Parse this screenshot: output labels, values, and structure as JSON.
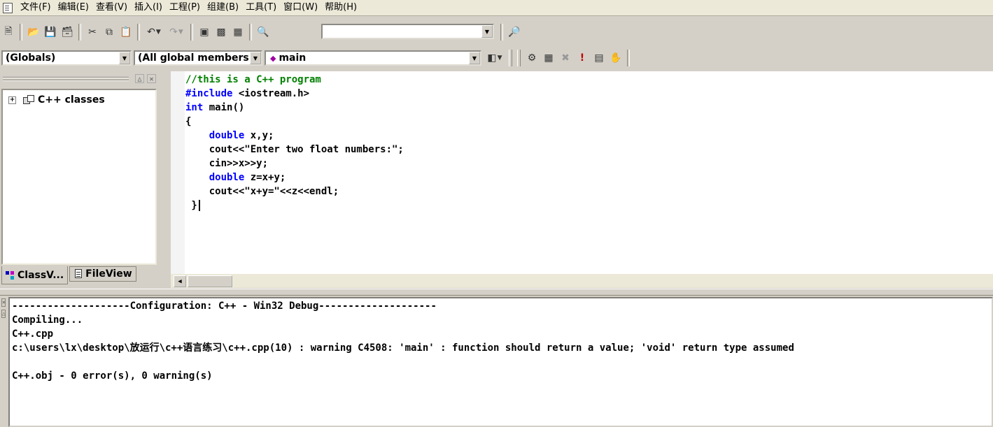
{
  "menubar": {
    "icon": "document-icon",
    "items": [
      "文件(F)",
      "编辑(E)",
      "查看(V)",
      "插入(I)",
      "工程(P)",
      "组建(B)",
      "工具(T)",
      "窗口(W)",
      "帮助(H)"
    ]
  },
  "toolbar1": {
    "icons": [
      "new-text-file-icon",
      "open-icon",
      "save-icon",
      "save-all-icon",
      "cut-icon",
      "copy-icon",
      "paste-icon",
      "undo-icon",
      "redo-icon",
      "workspace-icon",
      "output-icon",
      "window-list-icon",
      "find-in-files-icon",
      "find-icon"
    ],
    "find_value": ""
  },
  "toolbar2": {
    "scope": "(Globals)",
    "filter": "(All global members",
    "member": "main",
    "icons": [
      "wizard-bar-actions-icon",
      "compile-icon",
      "build-icon",
      "stop-build-icon",
      "execute-icon",
      "go-icon",
      "insert-breakpoint-icon"
    ]
  },
  "classview": {
    "tree_root": "C++ classes",
    "tabs": [
      {
        "label": "ClassV...",
        "icon": "classview-tab-icon",
        "active": false
      },
      {
        "label": "FileView",
        "icon": "fileview-tab-icon",
        "active": true
      }
    ]
  },
  "editor": {
    "lines": [
      [
        {
          "t": "//this is a C++ program",
          "c": "cm"
        }
      ],
      [
        {
          "t": "#include",
          "c": "kw"
        },
        {
          "t": " <iostream.h>",
          "c": ""
        }
      ],
      [
        {
          "t": "int",
          "c": "kw"
        },
        {
          "t": " main()",
          "c": ""
        }
      ],
      [
        {
          "t": "{",
          "c": ""
        }
      ],
      [
        {
          "t": "    ",
          "c": ""
        },
        {
          "t": "double",
          "c": "kw"
        },
        {
          "t": " x,y;",
          "c": ""
        }
      ],
      [
        {
          "t": "    cout<<\"Enter two float numbers:\";",
          "c": ""
        }
      ],
      [
        {
          "t": "    cin>>x>>y;",
          "c": ""
        }
      ],
      [
        {
          "t": "    ",
          "c": ""
        },
        {
          "t": "double",
          "c": "kw"
        },
        {
          "t": " z=x+y;",
          "c": ""
        }
      ],
      [
        {
          "t": "    cout<<\"x+y=\"<<z<<endl;",
          "c": ""
        }
      ],
      [
        {
          "t": " }",
          "c": ""
        }
      ]
    ]
  },
  "output": {
    "lines": [
      "--------------------Configuration: C++ - Win32 Debug--------------------",
      "Compiling...",
      "C++.cpp",
      "c:\\users\\lx\\desktop\\放运行\\c++语言练习\\c++.cpp(10) : warning C4508: 'main' : function should return a value; 'void' return type assumed",
      "",
      "C++.obj - 0 error(s), 0 warning(s)"
    ]
  },
  "colors": {
    "comment": "#008000",
    "keyword": "#0000ff",
    "chrome": "#d4d0c8",
    "menubar": "#ece9d8"
  }
}
